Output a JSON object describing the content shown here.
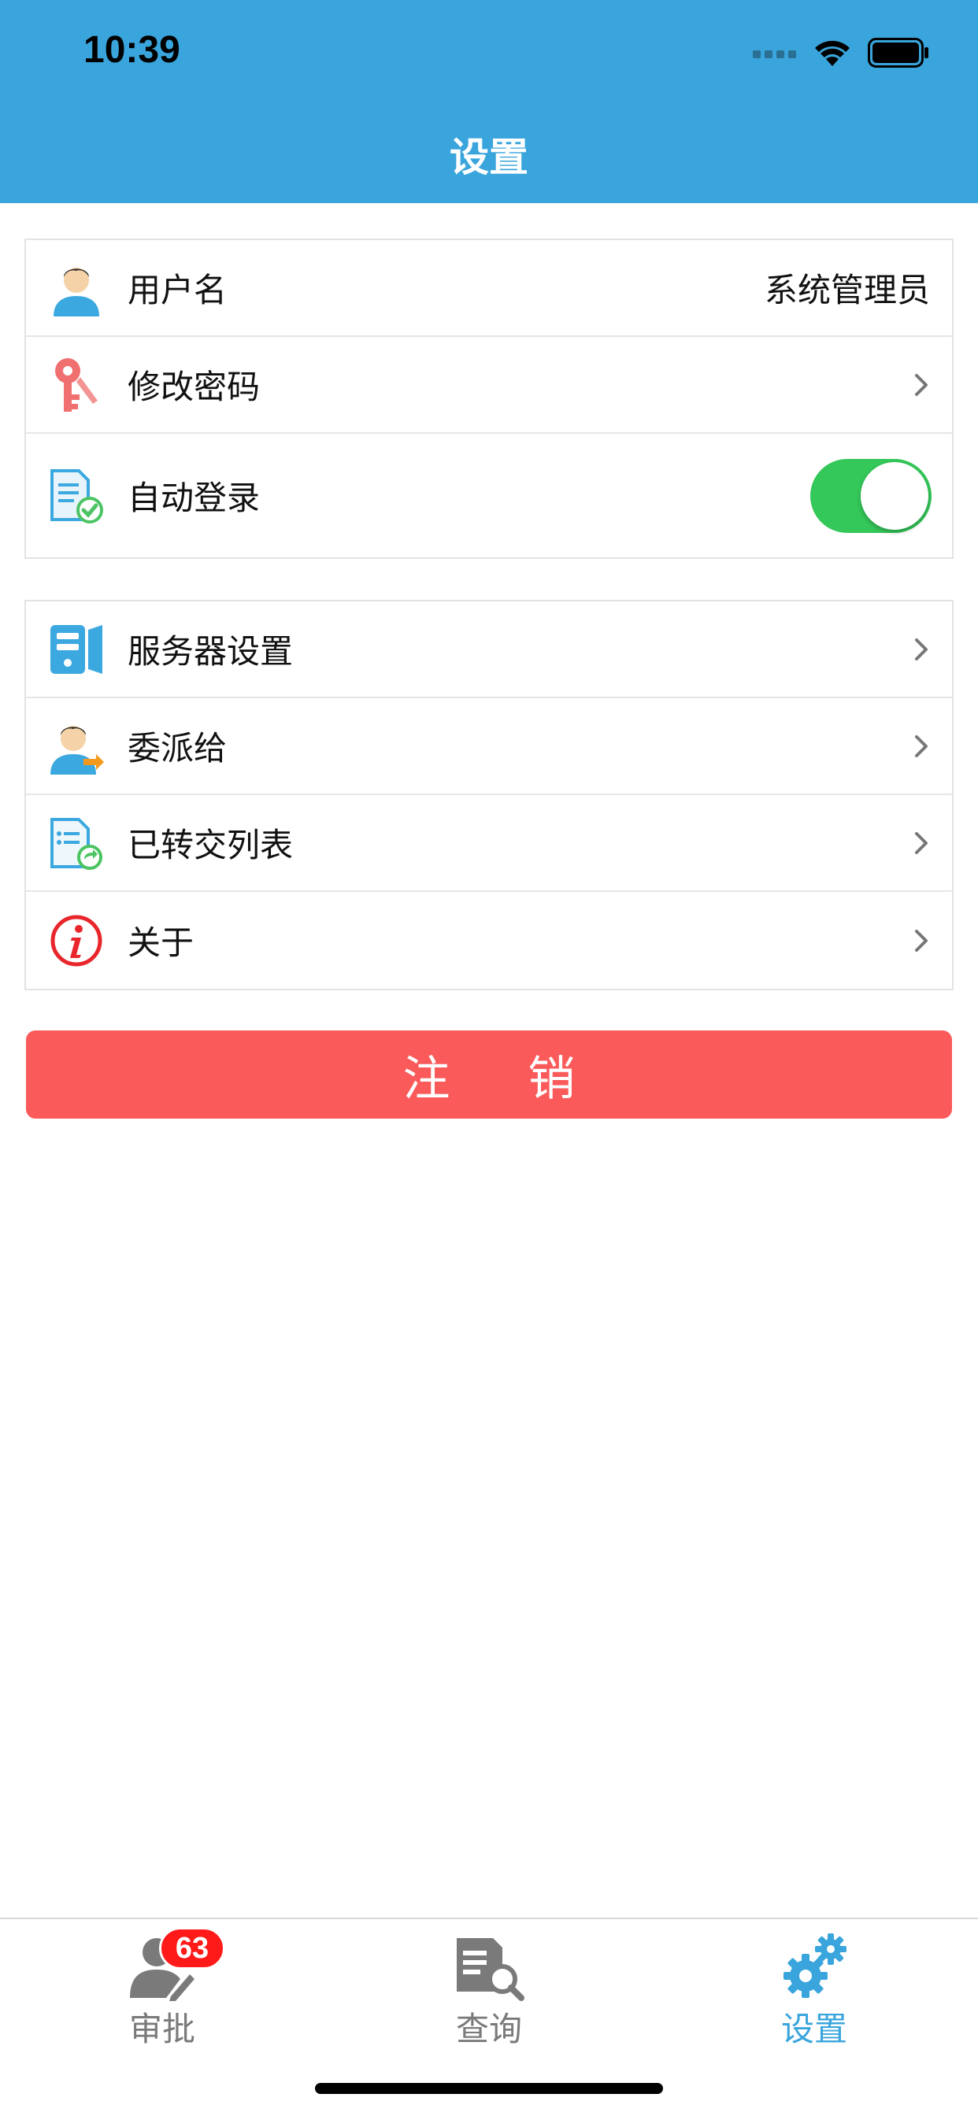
{
  "status_bar": {
    "time": "10:39"
  },
  "header": {
    "title": "设置"
  },
  "settings": {
    "username_label": "用户名",
    "username_value": "系统管理员",
    "change_password": "修改密码",
    "auto_login": "自动登录",
    "auto_login_on": true,
    "server_settings": "服务器设置",
    "delegate": "委派给",
    "transferred_list": "已转交列表",
    "about": "关于"
  },
  "logout_label": "注 销",
  "tabbar": {
    "approve": "审批",
    "approve_badge": "63",
    "query": "查询",
    "settings": "设置"
  },
  "colors": {
    "header": "#39a5dc",
    "logout": "#fa5a5a",
    "toggle_on": "#34c759",
    "badge": "#ff1a1a",
    "active_tab": "#39a5dc",
    "inactive_tab": "#7a7a7a"
  }
}
